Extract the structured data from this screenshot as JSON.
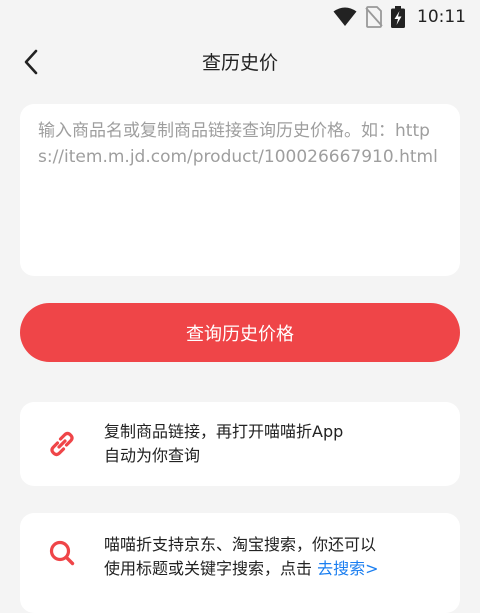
{
  "status_bar": {
    "time": "10:11",
    "icons": [
      "wifi-icon",
      "no-sim-icon",
      "battery-charging-icon"
    ]
  },
  "header": {
    "title": "查历史价",
    "back_icon": "chevron-left-icon"
  },
  "search": {
    "placeholder": "输入商品名或复制商品链接查询历史价格。如：https://item.m.jd.com/product/100026667910.html",
    "value": ""
  },
  "query_button": {
    "label": "查询历史价格",
    "color": "#ef4548"
  },
  "tips": [
    {
      "icon": "link-icon",
      "line1": "复制商品链接，再打开喵喵折App",
      "line2": "自动为你查询"
    },
    {
      "icon": "search-icon",
      "line1": "喵喵折支持京东、淘宝搜索，你还可以",
      "line2_prefix": "使用标题或关键字搜索，点击 ",
      "link_label": "去搜索>"
    }
  ],
  "colors": {
    "accent": "#ef4548",
    "link": "#1a7ef0",
    "background": "#f4f4f4"
  }
}
